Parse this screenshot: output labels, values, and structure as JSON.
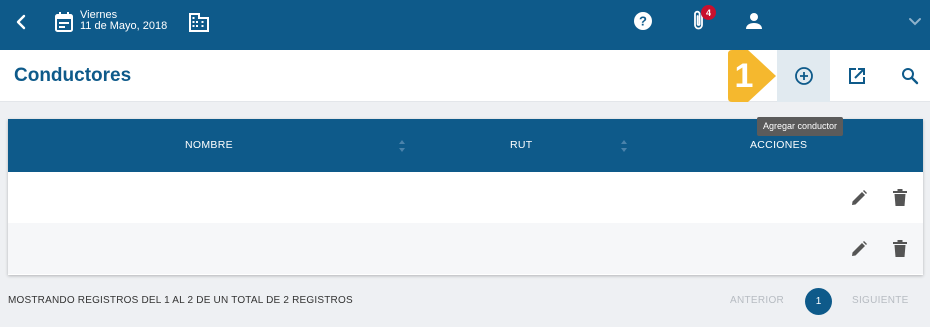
{
  "topbar": {
    "day": "Viernes",
    "date": "11 de Mayo, 2018",
    "attachments_badge": "4"
  },
  "page": {
    "title": "Conductores"
  },
  "tutorial": {
    "step": "1"
  },
  "tooltip": "Agregar conductor",
  "table": {
    "columns": [
      "NOMBRE",
      "RUT",
      "ACCIONES"
    ],
    "rows": [
      {
        "nombre": "",
        "rut": ""
      },
      {
        "nombre": "",
        "rut": ""
      }
    ]
  },
  "footer": {
    "summary": "MOSTRANDO REGISTROS DEL 1 AL 2 DE UN TOTAL DE 2 REGISTROS",
    "prev": "ANTERIOR",
    "current_page": "1",
    "next": "SIGUIENTE"
  },
  "colors": {
    "brand": "#0e5a8a",
    "accent_step": "#f5b82e",
    "badge": "#c8102e"
  }
}
